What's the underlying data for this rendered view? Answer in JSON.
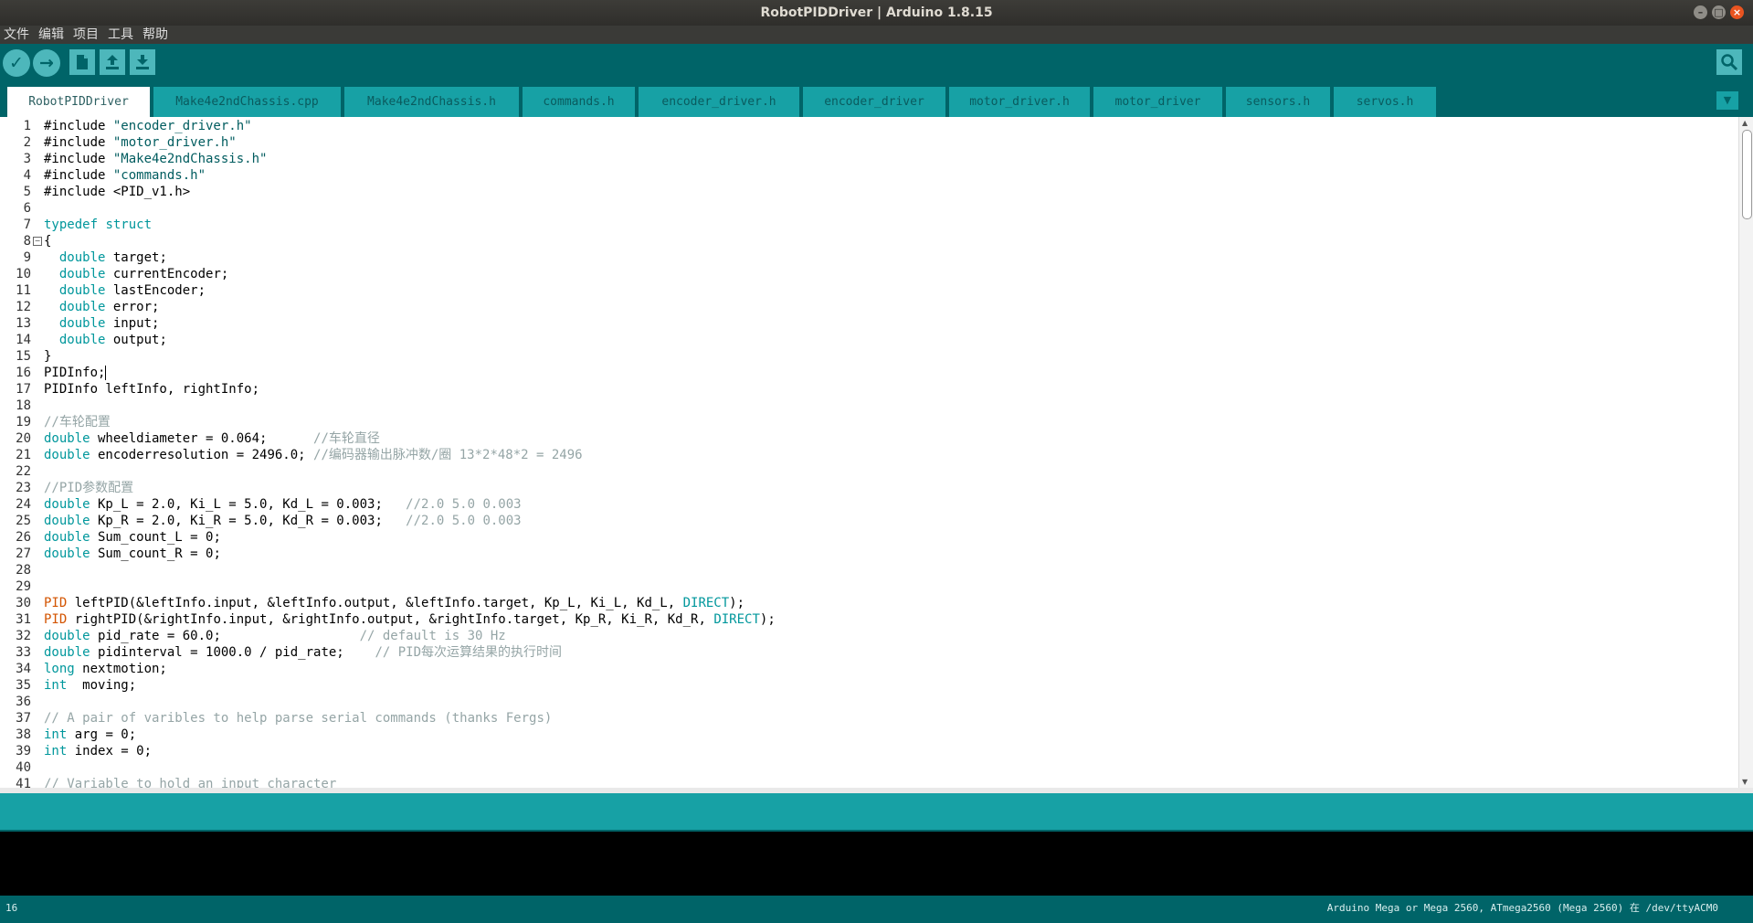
{
  "window": {
    "title": "RobotPIDDriver | Arduino 1.8.15"
  },
  "menu": [
    "文件",
    "编辑",
    "项目",
    "工具",
    "帮助"
  ],
  "toolbar": {
    "verify_icon": "check-icon",
    "upload_icon": "arrow-right-icon",
    "new_icon": "document-icon",
    "open_icon": "arrow-up-icon",
    "save_icon": "arrow-down-icon",
    "serial_icon": "magnifier-icon"
  },
  "tabs": [
    "RobotPIDDriver",
    "Make4e2ndChassis.cpp",
    "Make4e2ndChassis.h",
    "commands.h",
    "encoder_driver.h",
    "encoder_driver",
    "motor_driver.h",
    "motor_driver",
    "sensors.h",
    "servos.h"
  ],
  "active_tab": 0,
  "editor": {
    "line_numbers": [
      "1",
      "2",
      "3",
      "4",
      "5",
      "6",
      "7",
      "8",
      "9",
      "10",
      "11",
      "12",
      "13",
      "14",
      "15",
      "16",
      "17",
      "18",
      "19",
      "20",
      "21",
      "22",
      "23",
      "24",
      "25",
      "26",
      "27",
      "28",
      "29",
      "30",
      "31",
      "32",
      "33",
      "34",
      "35",
      "36",
      "37",
      "38",
      "39",
      "40",
      "41"
    ],
    "lines": [
      [
        [
          "#include ",
          ""
        ],
        [
          "\"encoder_driver.h\"",
          "lit"
        ]
      ],
      [
        [
          "#include ",
          ""
        ],
        [
          "\"motor_driver.h\"",
          "lit"
        ]
      ],
      [
        [
          "#include ",
          ""
        ],
        [
          "\"Make4e2ndChassis.h\"",
          "lit"
        ]
      ],
      [
        [
          "#include ",
          ""
        ],
        [
          "\"commands.h\"",
          "lit"
        ]
      ],
      [
        [
          "#include ",
          ""
        ],
        [
          "<PID_v1.h>",
          ""
        ]
      ],
      [],
      [
        [
          "typedef",
          "kw"
        ],
        [
          " ",
          ""
        ],
        [
          "struct",
          "kw"
        ]
      ],
      [
        [
          "{",
          ""
        ]
      ],
      [
        [
          "  ",
          ""
        ],
        [
          "double",
          "kw"
        ],
        [
          " target;",
          ""
        ]
      ],
      [
        [
          "  ",
          ""
        ],
        [
          "double",
          "kw"
        ],
        [
          " currentEncoder;",
          ""
        ]
      ],
      [
        [
          "  ",
          ""
        ],
        [
          "double",
          "kw"
        ],
        [
          " lastEncoder;",
          ""
        ]
      ],
      [
        [
          "  ",
          ""
        ],
        [
          "double",
          "kw"
        ],
        [
          " error;",
          ""
        ]
      ],
      [
        [
          "  ",
          ""
        ],
        [
          "double",
          "kw"
        ],
        [
          " input;",
          ""
        ]
      ],
      [
        [
          "  ",
          ""
        ],
        [
          "double",
          "kw"
        ],
        [
          " output;",
          ""
        ]
      ],
      [
        [
          "}",
          ""
        ]
      ],
      [
        [
          "PIDInfo;",
          ""
        ]
      ],
      [
        [
          "PIDInfo leftInfo, rightInfo;",
          ""
        ]
      ],
      [],
      [
        [
          "//车轮配置",
          "cm"
        ]
      ],
      [
        [
          "double",
          "kw"
        ],
        [
          " wheeldiameter = 0.064;      ",
          ""
        ],
        [
          "//车轮直径",
          "cm"
        ]
      ],
      [
        [
          "double",
          "kw"
        ],
        [
          " encoderresolution = 2496.0; ",
          ""
        ],
        [
          "//编码器输出脉冲数/圈 13*2*48*2 = 2496",
          "cm"
        ]
      ],
      [],
      [
        [
          "//PID参数配置",
          "cm"
        ]
      ],
      [
        [
          "double",
          "kw"
        ],
        [
          " Kp_L = 2.0, Ki_L = 5.0, Kd_L = 0.003;   ",
          ""
        ],
        [
          "//2.0 5.0 0.003",
          "cm"
        ]
      ],
      [
        [
          "double",
          "kw"
        ],
        [
          " Kp_R = 2.0, Ki_R = 5.0, Kd_R = 0.003;   ",
          ""
        ],
        [
          "//2.0 5.0 0.003",
          "cm"
        ]
      ],
      [
        [
          "double",
          "kw"
        ],
        [
          " Sum_count_L = 0;",
          ""
        ]
      ],
      [
        [
          "double",
          "kw"
        ],
        [
          " Sum_count_R = 0;",
          ""
        ]
      ],
      [],
      [],
      [
        [
          "PID",
          "type"
        ],
        [
          " leftPID(&leftInfo.input, &leftInfo.output, &leftInfo.target, Kp_L, Ki_L, Kd_L, ",
          ""
        ],
        [
          "DIRECT",
          "const"
        ],
        [
          ");",
          ""
        ]
      ],
      [
        [
          "PID",
          "type"
        ],
        [
          " rightPID(&rightInfo.input, &rightInfo.output, &rightInfo.target, Kp_R, Ki_R, Kd_R, ",
          ""
        ],
        [
          "DIRECT",
          "const"
        ],
        [
          ");",
          ""
        ]
      ],
      [
        [
          "double",
          "kw"
        ],
        [
          " pid_rate = 60.0;                  ",
          ""
        ],
        [
          "// default is 30 Hz",
          "cm"
        ]
      ],
      [
        [
          "double",
          "kw"
        ],
        [
          " pidinterval = 1000.0 / pid_rate;    ",
          ""
        ],
        [
          "// PID每次运算结果的执行时间",
          "cm"
        ]
      ],
      [
        [
          "long",
          "kw"
        ],
        [
          " nextmotion;",
          ""
        ]
      ],
      [
        [
          "int",
          "kw"
        ],
        [
          "  moving;",
          ""
        ]
      ],
      [],
      [
        [
          "// A pair of varibles to help parse serial commands (thanks Fergs)",
          "cm"
        ]
      ],
      [
        [
          "int",
          "kw"
        ],
        [
          " arg = 0;",
          ""
        ]
      ],
      [
        [
          "int",
          "kw"
        ],
        [
          " index = 0;",
          ""
        ]
      ],
      [],
      [
        [
          "// Variable to hold an input character",
          "cm"
        ]
      ]
    ]
  },
  "status": {
    "line": "16",
    "board": "Arduino Mega or Mega 2560, ATmega2560 (Mega 2560) 在 /dev/ttyACM0"
  }
}
